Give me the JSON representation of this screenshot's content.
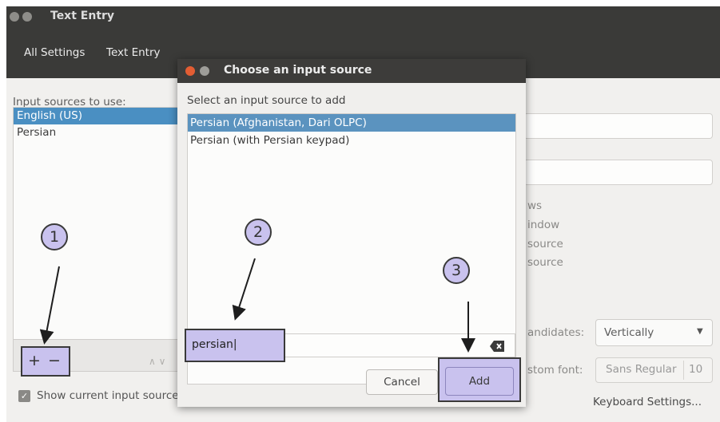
{
  "window": {
    "title": "Text Entry",
    "tabs": [
      "All Settings",
      "Text Entry"
    ]
  },
  "sources": {
    "label": "Input sources to use:",
    "items": [
      "English (US)",
      "Persian"
    ],
    "selected_index": 0,
    "add_symbol": "+",
    "remove_symbol": "−",
    "up_symbol": "∧ ∨"
  },
  "footer": {
    "show_label": "Show current input source in the menu bar",
    "show_checked": true,
    "keyboard_settings": "Keyboard Settings..."
  },
  "right_panel": {
    "partial_texts": [
      "ws",
      "indow",
      "source",
      "source"
    ],
    "candidates_label": "andidates:",
    "candidates_value": "Vertically",
    "font_label": "stom font:",
    "font_name": "Sans Regular",
    "font_size": "10"
  },
  "dialog": {
    "title": "Choose an input source",
    "prompt": "Select an input source to add",
    "items": [
      "Persian (Afghanistan, Dari OLPC)",
      "Persian (with Persian keypad)"
    ],
    "selected_index": 0,
    "search_value": "persian",
    "cancel_label": "Cancel",
    "add_label": "Add"
  },
  "annotations": [
    "1",
    "2",
    "3"
  ],
  "colors": {
    "highlight": "#c9c2ee",
    "selection": "#4a8fc2",
    "titlebar": "#3a3a38",
    "close_button": "#e35d33"
  }
}
